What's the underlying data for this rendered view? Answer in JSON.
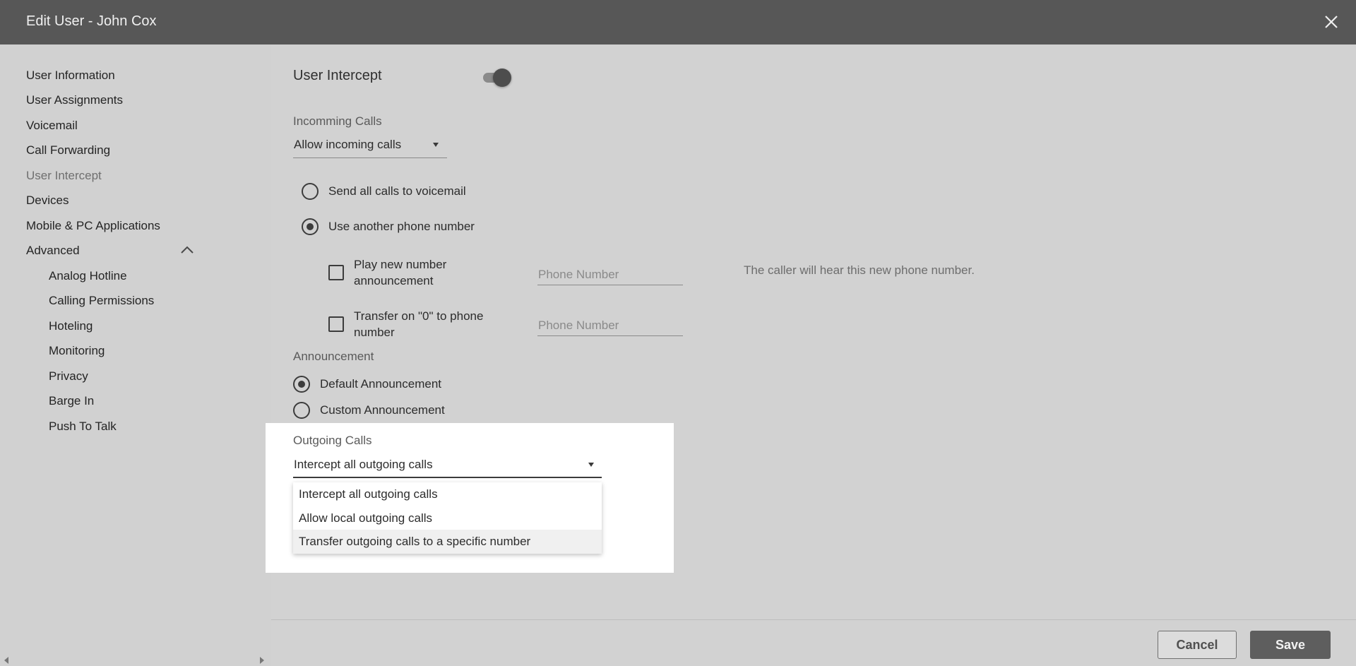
{
  "dialog": {
    "title": "Edit User - John Cox"
  },
  "sidebar": {
    "items": [
      {
        "label": "User Information"
      },
      {
        "label": "User Assignments"
      },
      {
        "label": "Voicemail"
      },
      {
        "label": "Call Forwarding"
      },
      {
        "label": "User Intercept"
      },
      {
        "label": "Devices"
      },
      {
        "label": "Mobile & PC Applications"
      },
      {
        "label": "Advanced"
      }
    ],
    "active": "User Intercept",
    "advanced_items": [
      {
        "label": "Analog Hotline"
      },
      {
        "label": "Calling Permissions"
      },
      {
        "label": "Hoteling"
      },
      {
        "label": "Monitoring"
      },
      {
        "label": "Privacy"
      },
      {
        "label": "Barge In"
      },
      {
        "label": "Push To Talk"
      }
    ]
  },
  "main": {
    "title": "User Intercept",
    "intercept_enabled": true,
    "incoming": {
      "label": "Incomming Calls",
      "selected": "Allow incoming calls",
      "options": {
        "send_voicemail": "Send all calls to voicemail",
        "use_another": "Use another phone number"
      },
      "selected_option": "Use another phone number",
      "play_new_number": {
        "label_line1": "Play new number",
        "label_line2": "announcement",
        "placeholder": "Phone Number",
        "checked": false
      },
      "transfer_zero": {
        "label_line1": "Transfer on \"0\" to phone",
        "label_line2": "number",
        "placeholder": "Phone Number",
        "checked": false
      },
      "hint": "The caller will hear this new phone number."
    },
    "announcement": {
      "label": "Announcement",
      "default": "Default Announcement",
      "custom": "Custom Announcement",
      "selected": "Default Announcement"
    },
    "outgoing": {
      "label": "Outgoing Calls",
      "selected": "Intercept all outgoing calls",
      "options": [
        "Intercept all outgoing calls",
        "Allow local outgoing calls",
        "Transfer outgoing calls to a specific number"
      ],
      "hovered_option": "Transfer outgoing calls to a specific number"
    }
  },
  "footer": {
    "cancel_label": "Cancel",
    "save_label": "Save"
  },
  "icons": {
    "close": "close-icon",
    "collapse": "chevron-up-icon",
    "caret": "caret-down-icon"
  }
}
